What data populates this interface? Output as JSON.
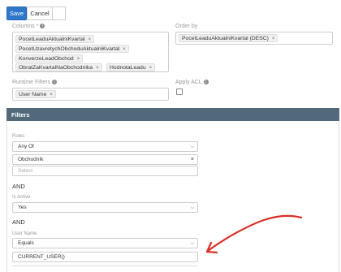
{
  "toolbar": {
    "save_label": "Save",
    "cancel_label": "Cancel"
  },
  "columns": {
    "label": "Columns *",
    "tags": [
      "PocetLeaduAktualniKvartal",
      "PocetUzavretychObchoduAktualniKvartal",
      "KonverzeLeadObchod",
      "ObratZaKvartalNaObchodnika",
      "HodnotaLeadu"
    ]
  },
  "order_by": {
    "label": "Order by",
    "tags": [
      "PocetLeaduAktualniKvartal (DESC)"
    ]
  },
  "runtime_filters": {
    "label": "Runtime Filters",
    "tags": [
      "User Name"
    ]
  },
  "apply_acl": {
    "label": "Apply ACL"
  },
  "filters_section": {
    "title": "Filters"
  },
  "roles": {
    "label": "Roles",
    "operator": "Any Of",
    "selected": "Obchodník",
    "placeholder": "Select"
  },
  "and_labels": [
    "AND",
    "AND"
  ],
  "is_active": {
    "label": "Is Active",
    "value": "Yes"
  },
  "user_name": {
    "label": "User Name",
    "operator": "Equals",
    "value": "CURRENT_USER()"
  },
  "remove_glyph": "×",
  "annotation_color": "#d93025"
}
